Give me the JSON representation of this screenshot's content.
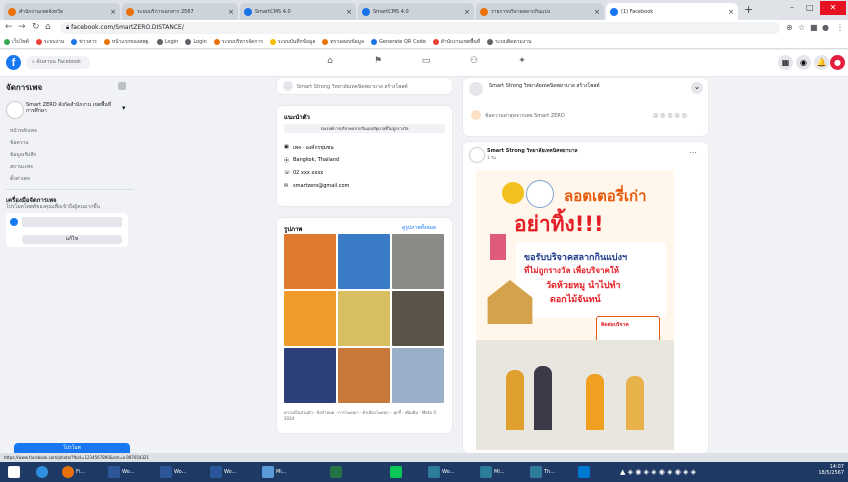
{
  "browser": {
    "tabs": [
      {
        "label": "สำนักงานเขตจังหวัด",
        "color": "#e8710a"
      },
      {
        "label": "ระบบบริการเอกสาร 2567",
        "color": "#e8710a"
      },
      {
        "label": "SmartCMS 4.0",
        "color": "#1a73e8"
      },
      {
        "label": "SmartCMS 4.0",
        "color": "#1a73e8"
      },
      {
        "label": "รายการบริจาคสลากกินแบ่ง",
        "color": "#e8710a"
      },
      {
        "label": "(1) Facebook",
        "color": "#1877f2"
      }
    ],
    "new_tab": "+",
    "window_controls": [
      "–",
      "□",
      "✕"
    ],
    "url": "facebook.com/SmartZERO.DISTANCE/",
    "bookmarks": [
      {
        "label": "เว็บไซต์",
        "color": "#34a853"
      },
      {
        "label": "ระบบงาน",
        "color": "#ea4335"
      },
      {
        "label": "ข่าวสาร",
        "color": "#1a73e8"
      },
      {
        "label": "หน้าแรกของสพฐ.",
        "color": "#e8710a"
      },
      {
        "label": "Login",
        "color": "#5f6368"
      },
      {
        "label": "Login",
        "color": "#5f6368"
      },
      {
        "label": "ระบบบริหารจัดการ",
        "color": "#e8710a"
      },
      {
        "label": "ระบบบันทึกข้อมูล",
        "color": "#fbbc04"
      },
      {
        "label": "ตรวจสอบข้อมูล",
        "color": "#e8710a"
      },
      {
        "label": "Generate QR Code",
        "color": "#1a73e8"
      },
      {
        "label": "สำนักงานเขตพื้นที่",
        "color": "#ea4335"
      },
      {
        "label": "ระบบติดตามงาน",
        "color": "#5f6368"
      }
    ]
  },
  "facebook": {
    "logo": "f",
    "search_placeholder": "ค้นหาบน Facebook",
    "nav_icons": [
      "home-icon",
      "flag-icon",
      "store-icon",
      "groups-icon",
      "gaming-icon"
    ],
    "right_icons": [
      "▦",
      "◉",
      "🔔",
      "●"
    ]
  },
  "sidebar": {
    "title": "จัดการเพจ",
    "page_name": "Smart ZERO สังกัดสำนักงาน เขตพื้นที่การศึกษา",
    "items": [
      "หน้าหลักเพจ",
      "ข้อความ",
      "ข้อมูลเชิงลึก",
      "สถานะเพจ",
      "ตั้งค่าเพจ"
    ],
    "promo_title": "เครื่องมือจัดการเพจ",
    "promo_text": "โปรโมตโพสต์ของคุณเพื่อเข้าถึงผู้คนมากขึ้น",
    "promo_button": "แก้ไข",
    "bottom_button": "โปรโมต"
  },
  "center": {
    "create_post": "Smart Strong วิทยาลัยเทคนิคพยาบาล สร้างโพสต์",
    "intro_title": "แนะนำตัว",
    "intro_text": "รณรงค์การบริจาคสลากกินแบ่งรัฐบาลที่ไม่ถูกรางวัล",
    "details": [
      "เพจ · องค์กรชุมชน",
      "Bangkok, Thailand",
      "02 xxx xxxx",
      "smartzero@gmail.com"
    ],
    "photos_title": "รูปภาพ",
    "photos_link": "ดูรูปภาพทั้งหมด",
    "footer": "ความเป็นส่วนตัว · ข้อกำหนด · การโฆษณา · ตัวเลือกโฆษณา · คุกกี้ · เพิ่มเติม · Meta © 2024"
  },
  "feed": {
    "top_post_text": "ข้อความล่าสุดจากเพจ Smart ZERO",
    "page_name": "Smart Strong วิทยาลัยเทคนิคพยาบาล",
    "post_time": "1 วัน",
    "poster": {
      "title": "ลอตเตอรี่เก่า",
      "headline": "อย่าทิ้ง!!!",
      "line1": "ขอรับบริจาคสลากกินแบ่งฯ",
      "line2": "ที่ไม่ถูกรางวัล เพื่อบริจาคให้",
      "line3": "วัดห้วยหมู นำไปทำ",
      "line4": "ดอกไม้จันทน์",
      "box_label": "ติดต่อบริจาค"
    }
  },
  "status_bar": "https://www.facebook.com/photo/?fbid=1234567890&set=a.987654321",
  "taskbar": {
    "items": [
      "Fi...",
      "Wo...",
      "Wo...",
      "Wo...",
      "Mi...",
      "Wo...",
      "Mi...",
      "Th..."
    ],
    "time": "14:07",
    "date": "18/5/2567"
  }
}
